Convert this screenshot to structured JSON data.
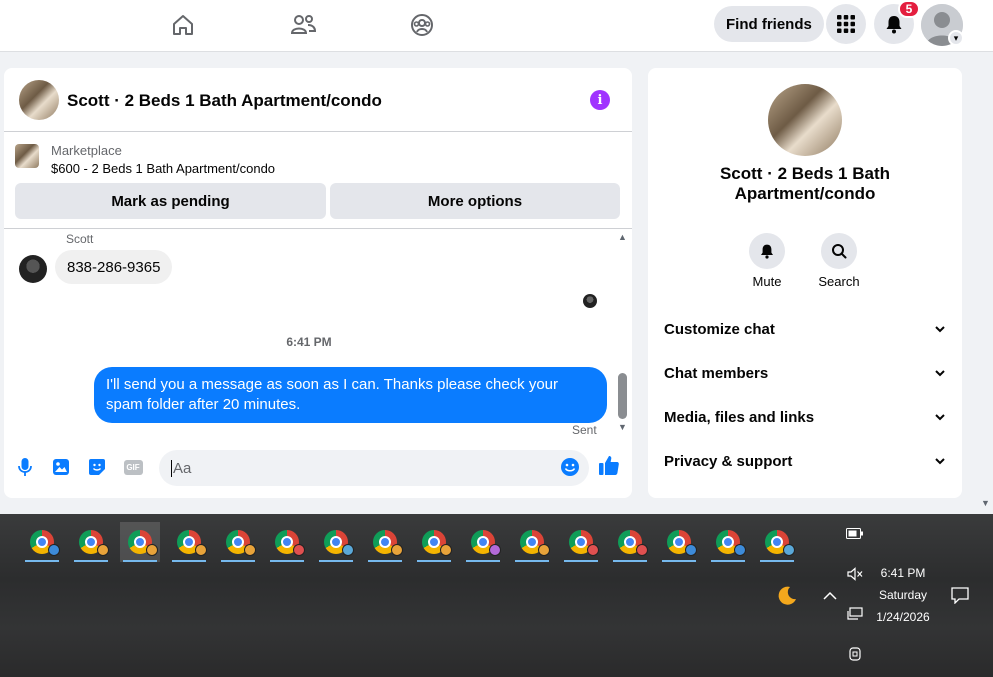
{
  "topnav": {
    "find_friends_label": "Find friends",
    "notification_count": "5"
  },
  "chat": {
    "title": "Scott · 2 Beds 1 Bath Apartment/condo",
    "marketplace": {
      "label": "Marketplace",
      "listing": "$600 - 2 Beds 1 Bath Apartment/condo",
      "mark_pending_label": "Mark as pending",
      "more_options_label": "More options"
    },
    "messages": {
      "sender_name": "Scott",
      "incoming_text": "838-286-9365",
      "time_separator": "6:41 PM",
      "outgoing_text": "I'll send you a message as soon as I can. Thanks please check your spam folder after 20 minutes.",
      "status": "Sent"
    },
    "composer": {
      "placeholder": "Aa",
      "gif_label": "GIF"
    }
  },
  "right_panel": {
    "title": "Scott · 2 Beds 1 Bath Apartment/condo",
    "actions": [
      {
        "label": "Mute",
        "icon": "bell-icon"
      },
      {
        "label": "Search",
        "icon": "search-icon"
      }
    ],
    "sections": [
      {
        "label": "Customize chat"
      },
      {
        "label": "Chat members"
      },
      {
        "label": "Media, files and links"
      },
      {
        "label": "Privacy & support"
      }
    ]
  },
  "taskbar": {
    "clock_time": "6:41 PM",
    "clock_day": "Saturday",
    "clock_date": "1/24/2026",
    "chrome_profile_colors": [
      "#3d8bd9",
      "#e8a33a",
      "#e8a33a",
      "#e8a33a",
      "#e8a33a",
      "#e05050",
      "#5aa8d8",
      "#e8a33a",
      "#e8a33a",
      "#b36ad9",
      "#e8a33a",
      "#e05050",
      "#e05050",
      "#3d8bd9",
      "#3d8bd9",
      "#5aa8d8"
    ]
  },
  "colors": {
    "accent_blue": "#0a7cff",
    "info_purple": "#a033ff",
    "badge_red": "#e41e3f"
  }
}
